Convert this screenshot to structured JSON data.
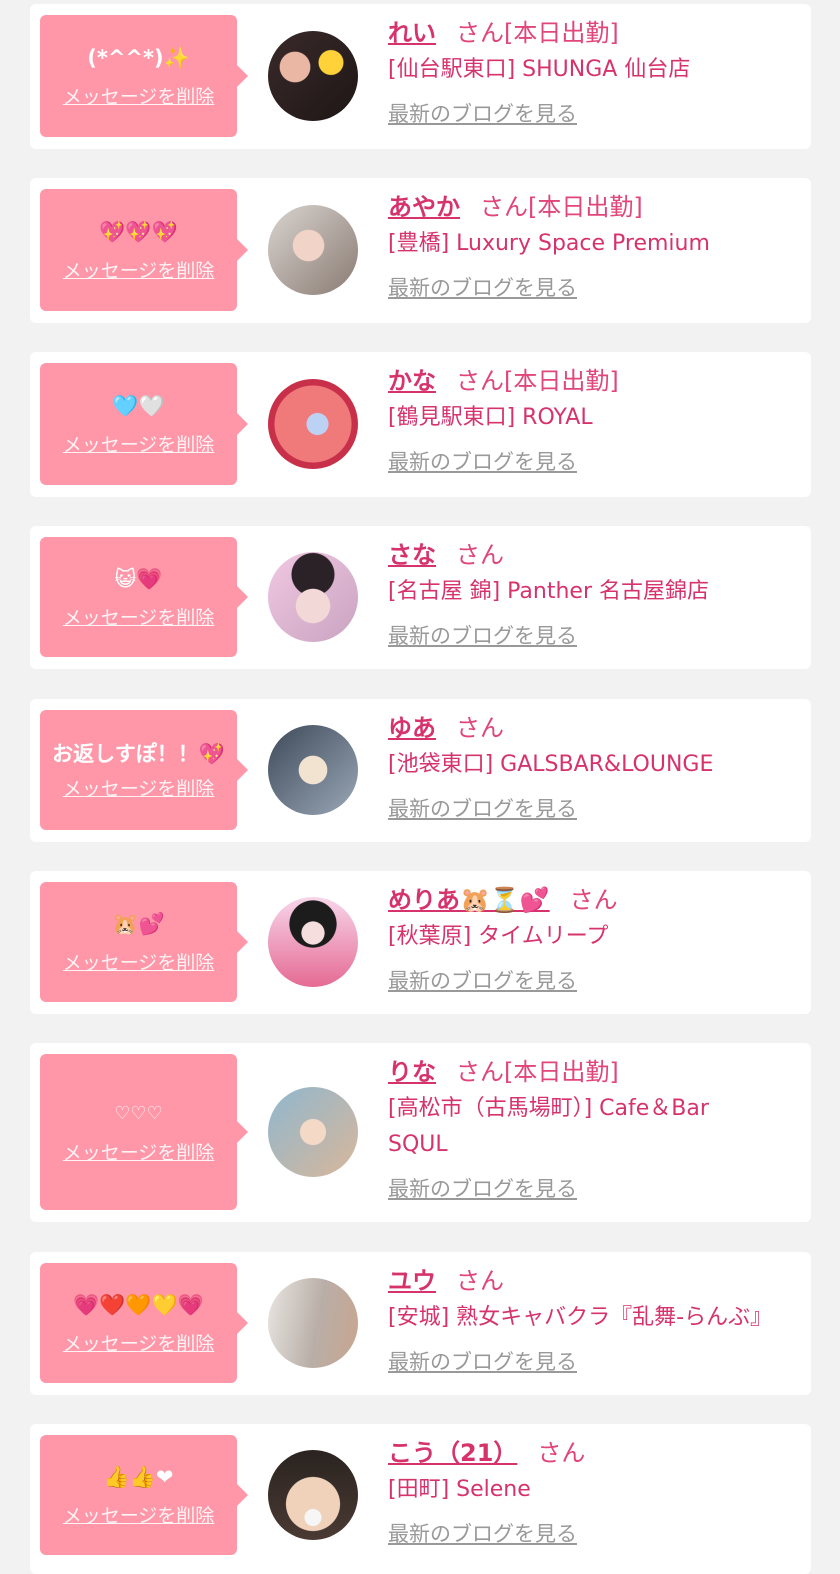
{
  "delete_label": "メッセージを削除",
  "san_label": "さん",
  "blog_label": "最新のブログを見る",
  "colors": {
    "bubble": "#ff97a8",
    "name": "#d6336c",
    "background": "#f2f2f2"
  },
  "items": [
    {
      "message": "(*^^*)✨",
      "name": "れい",
      "today": "[本日出勤]",
      "shop": "[仙台駅東口] SHUNGA 仙台店"
    },
    {
      "message": "💖💖💖",
      "name": "あやか",
      "today": "[本日出勤]",
      "shop": "[豊橋] Luxury Space Premium"
    },
    {
      "message": "🩵🤍",
      "name": "かな",
      "today": "[本日出勤]",
      "shop": "[鶴見駅東口] ROYAL"
    },
    {
      "message": "😺💗",
      "name": "さな",
      "today": "",
      "shop": "[名古屋 錦] Panther 名古屋錦店"
    },
    {
      "message": "お返しすぽ！！💖",
      "name": "ゆあ",
      "today": "",
      "shop": "[池袋東口] GALSBAR&LOUNGE"
    },
    {
      "message": "🐹💕",
      "name": "めりあ🐹⏳💕",
      "today": "",
      "shop": "[秋葉原] タイムリープ"
    },
    {
      "message": "♡♡♡",
      "name": "りな",
      "today": "[本日出勤]",
      "shop": "[高松市（古馬場町）] Cafe＆Bar SQUL"
    },
    {
      "message": "💗❤️🧡💛💗",
      "name": "ユウ",
      "today": "",
      "shop": "[安城] 熟女キャバクラ『乱舞-らんぶ』"
    },
    {
      "message": "👍👍❤",
      "name": "こう（21）",
      "today": "",
      "shop": "[田町] Selene"
    }
  ]
}
